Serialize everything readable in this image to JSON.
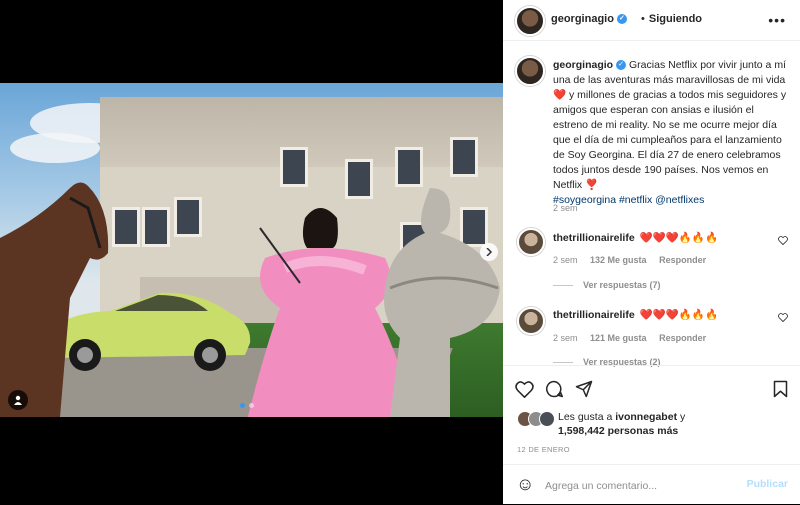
{
  "post": {
    "username": "georginagio",
    "verified_glyph": "✓",
    "separator": "•",
    "follow_status": "Siguiendo",
    "more_glyph": "•••",
    "caption_lines": [
      "Gracias Netflix por vivir junto a mí",
      "una de las aventuras más maravillosas de mi vida",
      "❤️ y millones de gracias a todos mis seguidores y",
      "amigos que esperan con ansias e ilusión el",
      "estreno de mi reality. No se me ocurre mejor día",
      "que el día de mi cumpleaños para el lanzamiento",
      "de Soy Georgina. El día 27 de enero celebramos",
      "todos juntos desde 190 países. Nos vemos en",
      "Netflix ❣️"
    ],
    "hashtags": "#soygeorgina #netflix @netflixes",
    "caption_age": "2 sem"
  },
  "comments": [
    {
      "username": "thetrillionairelife",
      "text": "❤️❤️❤️🔥🔥🔥",
      "age": "2 sem",
      "likes": "132 Me gusta",
      "reply": "Responder",
      "view_replies": "Ver respuestas (7)"
    },
    {
      "username": "thetrillionairelife",
      "text": "❤️❤️❤️🔥🔥🔥",
      "age": "2 sem",
      "likes": "121 Me gusta",
      "reply": "Responder",
      "view_replies": "Ver respuestas (2)"
    }
  ],
  "likes": {
    "prefix": "Les gusta a",
    "first_user": "ivonnegabet",
    "joiner": "y",
    "count": "1,598,442 personas más"
  },
  "date": "12 DE ENERO",
  "composer": {
    "placeholder": "Agrega un comentario...",
    "publish": "Publicar",
    "emoji_glyph": "☺"
  },
  "colors": {
    "accent": "#3897f0",
    "publish_disabled": "#b2dffc",
    "muted": "#8e8e8e",
    "hashtag": "#00376b"
  },
  "icons": [
    "heart-icon",
    "comment-icon",
    "share-icon",
    "bookmark-icon",
    "emoji-icon",
    "user-tag-icon",
    "carousel-next-icon"
  ]
}
